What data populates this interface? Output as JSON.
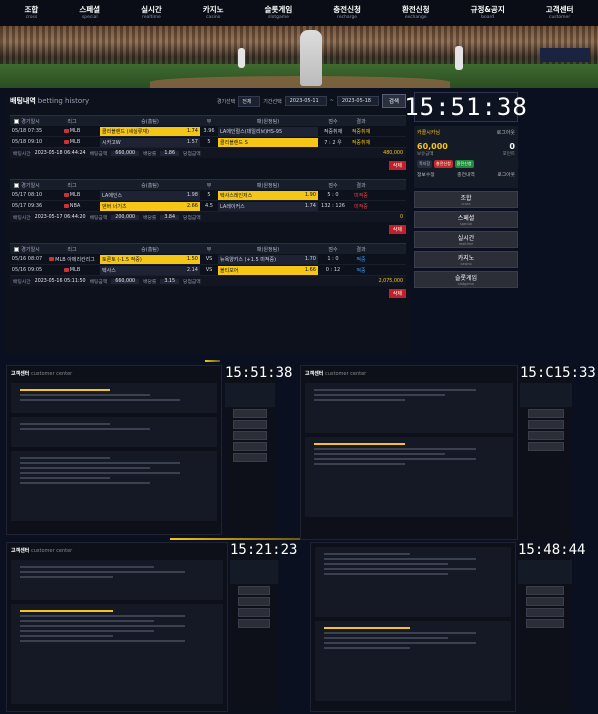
{
  "nav": [
    {
      "ko": "조합",
      "en": "cross"
    },
    {
      "ko": "스페셜",
      "en": "special"
    },
    {
      "ko": "실시간",
      "en": "realtime"
    },
    {
      "ko": "카지노",
      "en": "casino"
    },
    {
      "ko": "슬롯게임",
      "en": "slotgame"
    },
    {
      "ko": "충전신청",
      "en": "recharge"
    },
    {
      "ko": "환전신청",
      "en": "exchange"
    },
    {
      "ko": "규정&공지",
      "en": "board"
    },
    {
      "ko": "고객센터",
      "en": "customer"
    }
  ],
  "history": {
    "title": "배팅내역",
    "title_en": "betting history",
    "filter_label": "경기선택",
    "filter_value": "전체",
    "period_label": "기간선택",
    "date_from": "2023-05-11",
    "date_to": "2023-05-18",
    "search_label": "검색",
    "headers": {
      "time": "경기일시",
      "league": "리그",
      "home": "승(홈팀)",
      "vs": "무",
      "away": "패(원정팀)",
      "score": "점수",
      "result": "결과"
    },
    "summary_labels": {
      "time": "배팅시간",
      "amount": "배팅금액",
      "odds": "배당률",
      "win": "당첨금액"
    },
    "delete_label": "삭제",
    "bets": [
      {
        "rows": [
          {
            "time": "05/18 07:35",
            "league": "MLB",
            "home": "클리블랜드 (세실류재)",
            "home_odds": "1.74",
            "vs": "3.96",
            "away": "LA에인절스(데일리브)HS-95",
            "away_odds": "",
            "score": "적중취재",
            "result": "적중취재",
            "home_on": true,
            "away_on": false
          },
          {
            "time": "05/18 09:10",
            "league": "MLB",
            "home": "시카고W",
            "home_odds": "1.57",
            "vs": "5",
            "away": "클리블랜드 S",
            "away_odds": "",
            "score": "7 : 2 우",
            "result": "적중취재",
            "home_on": false,
            "away_on": true
          }
        ],
        "placed": "2023-05-18 06:44:24",
        "amount": "660,000",
        "odds": "1.86",
        "win": "480,000"
      },
      {
        "rows": [
          {
            "time": "05/17 08:10",
            "league": "MLB",
            "home": "LA에인스",
            "home_odds": "1.98",
            "vs": "5",
            "away": "텍사스레인저스",
            "away_odds": "1.90",
            "score": "5 : 0",
            "result": "미적중",
            "home_on": false,
            "away_on": true
          },
          {
            "time": "05/17 09:36",
            "league": "NBA",
            "home": "덴버 너기츠",
            "home_odds": "2.66",
            "vs": "4.5",
            "away": "LA레이커스",
            "away_odds": "1.74",
            "score": "132 : 126",
            "result": "미적중",
            "home_on": true,
            "away_on": false
          }
        ],
        "placed": "2023-05-17 06:44:20",
        "amount": "200,000",
        "odds": "3.84",
        "win": "0"
      },
      {
        "rows": [
          {
            "time": "05/16 08:07",
            "league": "MLB 아메리칸리그",
            "home": "토론토 (-1.5 적중)",
            "home_odds": "1.50",
            "vs": "VS",
            "away": "뉴욕양키스 (+1.5 미적중)",
            "away_odds": "1.70",
            "score": "1 : 0",
            "result": "적중",
            "home_on": true,
            "away_on": false
          },
          {
            "time": "05/16 09:05",
            "league": "MLB",
            "home": "텍사스",
            "home_odds": "2.14",
            "vs": "VS",
            "away": "볼티모어",
            "away_odds": "1.66",
            "score": "0 : 12",
            "result": "적중",
            "home_on": false,
            "away_on": true
          }
        ],
        "placed": "2023-05-16 05:11:50",
        "amount": "660,000",
        "odds": "3.15",
        "win": "2,075,000"
      }
    ]
  },
  "side": {
    "clock": "15:51:38",
    "username": "카콜시카님",
    "logout": "로그아웃",
    "money": "60,000",
    "money_label": "보유금액",
    "point": "0",
    "point_label": "포인트",
    "pill_recharge": "충전신청",
    "pill_exchange": "환전신청",
    "pill_note": "쪽지함",
    "tab1": "정보수정",
    "tab2": "충전내역",
    "tab3": "로그아웃",
    "menu": [
      {
        "ko": "조합",
        "en": "cross"
      },
      {
        "ko": "스페셜",
        "en": "special"
      },
      {
        "ko": "실시간",
        "en": "realtime"
      },
      {
        "ko": "카지노",
        "en": "casino"
      },
      {
        "ko": "슬롯게임",
        "en": "slotgame"
      }
    ]
  },
  "thumbs": {
    "title": "고객센터",
    "title_en": "customer center",
    "clock2": "15:C15:33",
    "clock3": "15:21:23",
    "clock4": "15:48:44"
  }
}
